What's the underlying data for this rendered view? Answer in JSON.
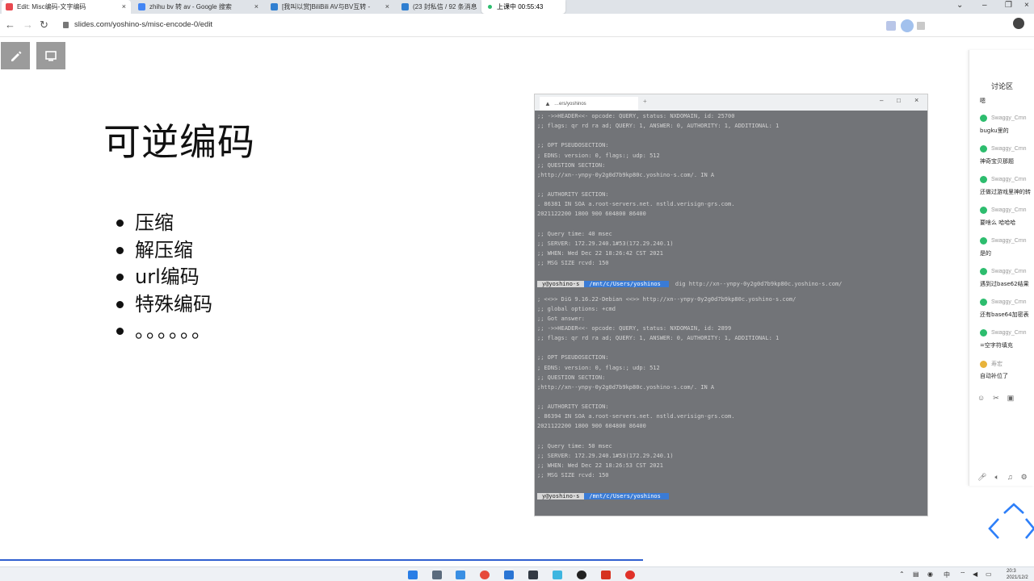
{
  "browser": {
    "tabs": [
      {
        "title": "Edit: Misc编码-文字编码",
        "fav_color": "#e8484f"
      },
      {
        "title": "zhihu bv 转 av - Google 搜索",
        "fav_color": "#4285f4"
      },
      {
        "title": "[我叫以赏]BiliBili AV与BV互转 -",
        "fav_color": "#2f7fd1"
      },
      {
        "title": "(23 封私信 / 92 条消息",
        "fav_color": "#2f7fd1"
      }
    ],
    "live_label": "上课中 00:55:43",
    "url": "slides.com/yoshino-s/misc-encode-0/edit"
  },
  "slide": {
    "title": "可逆编码",
    "bullets": [
      "压缩",
      "解压缩",
      "url编码",
      "特殊编码",
      "。。。。。。"
    ]
  },
  "terminal": {
    "tab_title": "…ers/yoshinos",
    "lines": [
      ";; ->>HEADER<<- opcode: QUERY, status: NXDOMAIN, id: 25700",
      ";; flags: qr rd ra ad; QUERY: 1, ANSWER: 0, AUTHORITY: 1, ADDITIONAL: 1",
      "",
      ";; OPT PSEUDOSECTION:",
      "; EDNS: version: 0, flags:; udp: 512",
      ";; QUESTION SECTION:",
      ";http://xn--ynpy-0y2g0d7b9kp80c.yoshino-s.com/.        IN A",
      "",
      ";; AUTHORITY SECTION:",
      ".                       86381   IN      SOA     a.root-servers.net. nstld.verisign-grs.com.",
      "2021122200 1800 900 604800 86400",
      "",
      ";; Query time: 40 msec",
      ";; SERVER: 172.29.240.1#53(172.29.240.1)",
      ";; WHEN: Wed Dec 22 18:26:42 CST 2021",
      ";; MSG SIZE  rcvd: 150",
      "",
      "",
      "",
      "; <<>> DiG 9.16.22-Debian <<>> http://xn--ynpy-0y2g0d7b9kp80c.yoshino-s.com/",
      ";; global options: +cmd",
      ";; Got answer:",
      ";; ->>HEADER<<- opcode: QUERY, status: NXDOMAIN, id: 2899",
      ";; flags: qr rd ra ad; QUERY: 1, ANSWER: 0, AUTHORITY: 1, ADDITIONAL: 1",
      "",
      ";; OPT PSEUDOSECTION:",
      "; EDNS: version: 0, flags:; udp: 512",
      ";; QUESTION SECTION:",
      ";http://xn--ynpy-0y2g0d7b9kp80c.yoshino-s.com/.        IN A",
      "",
      ";; AUTHORITY SECTION:",
      ".                       86394   IN      SOA     a.root-servers.net. nstld.verisign-grs.com.",
      "2021122200 1800 900 604800 86400",
      "",
      ";; Query time: 50 msec",
      ";; SERVER: 172.29.240.1#53(172.29.240.1)",
      ";; WHEN: Wed Dec 22 18:26:53 CST 2021",
      ";; MSG SIZE  rcvd: 150"
    ],
    "prompt1": {
      "user": "y@yoshino-s",
      "path": "/mnt/c/Users/yoshinos",
      "cmd": "dig http://xn--ynpy-0y2g0d7b9kp80c.yoshino-s.com/"
    },
    "prompt2": {
      "user": "y@yoshino-s",
      "path": "/mnt/c/Users/yoshinos",
      "cmd": ""
    }
  },
  "discussion": {
    "header": "讨论区",
    "first_line": "嗯",
    "messages": [
      {
        "user": "Swaggy_Cmn",
        "text": "bugku里的"
      },
      {
        "user": "Swaggy_Cmn",
        "text": "神奇宝贝那题"
      },
      {
        "user": "Swaggy_Cmn",
        "text": "还做过游戏里神的转"
      },
      {
        "user": "Swaggy_Cmn",
        "text": "要啥么 哈哈哈"
      },
      {
        "user": "Swaggy_Cmn",
        "text": "是的"
      },
      {
        "user": "Swaggy_Cmn",
        "text": "遇到过base62结果"
      },
      {
        "user": "Swaggy_Cmn",
        "text": "还有base64加密表"
      },
      {
        "user": "Swaggy_Cmn",
        "text": "=空字符填充"
      },
      {
        "user": "寿宏",
        "text": "自动补位了"
      }
    ]
  },
  "taskbar": {
    "ime": "中",
    "time": "20:3",
    "date": "2021/12/2"
  }
}
